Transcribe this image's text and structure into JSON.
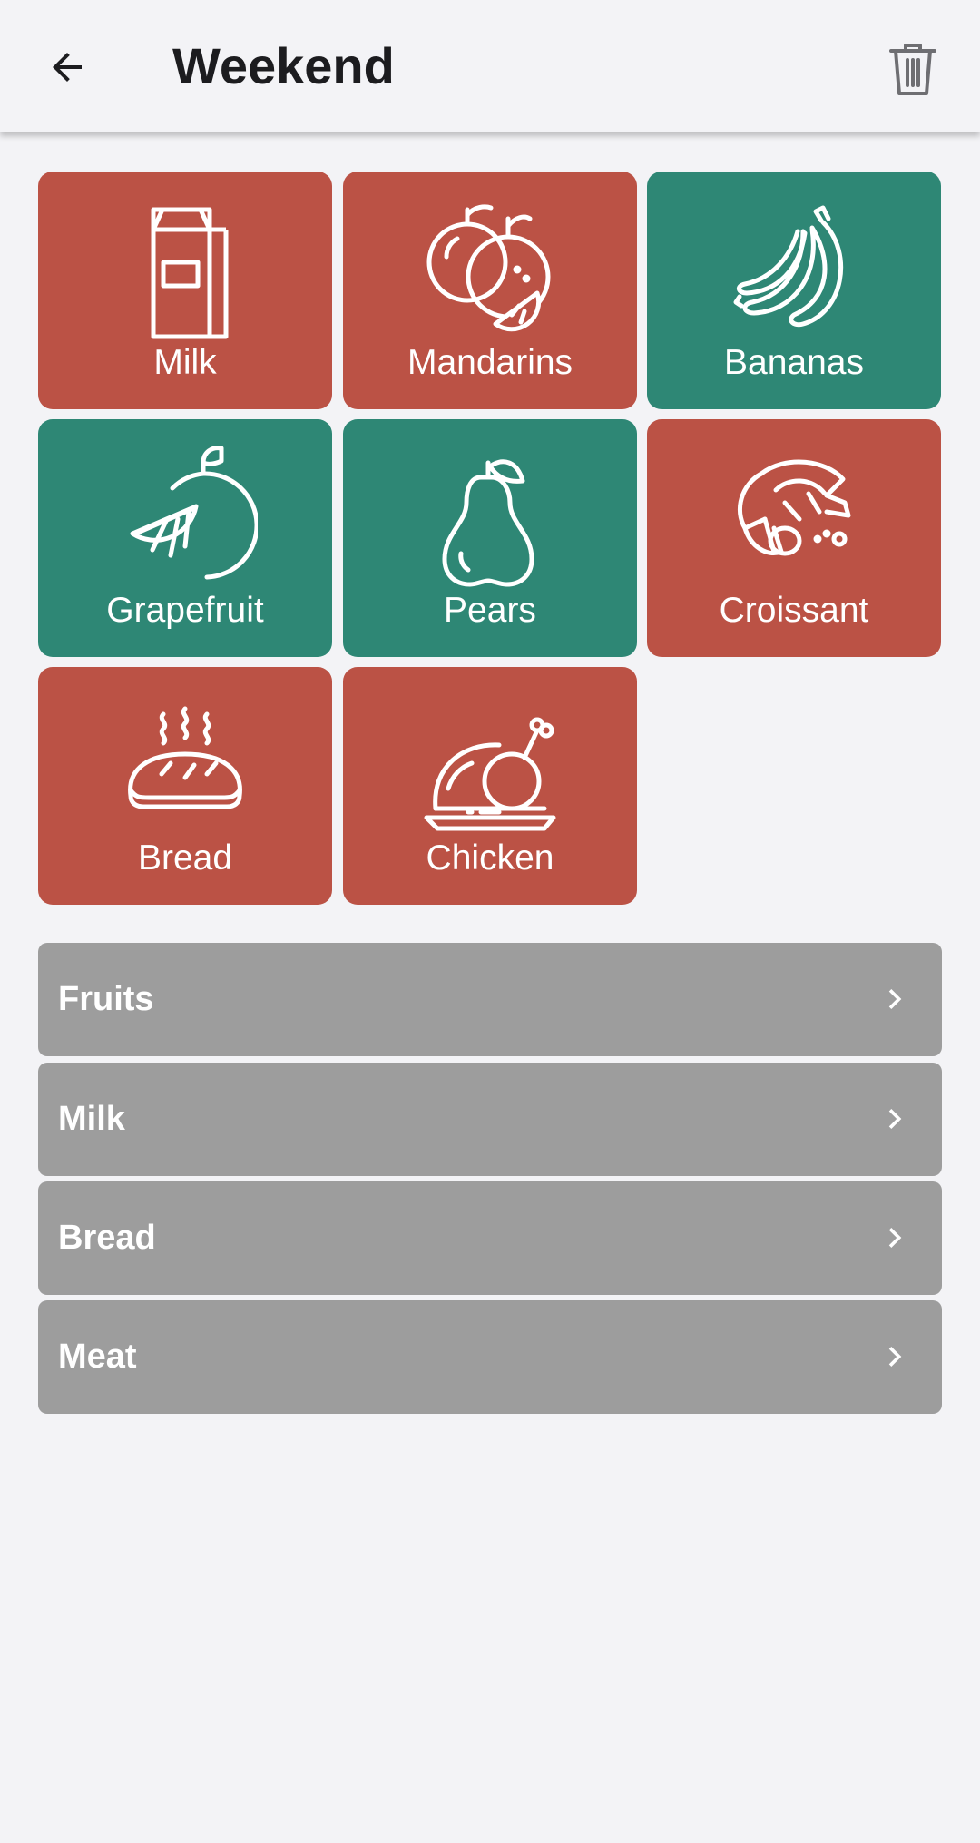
{
  "header": {
    "title": "Weekend",
    "back_icon": "arrow-back-icon",
    "delete_icon": "trash-icon"
  },
  "colors": {
    "not_purchased": "#bb5245",
    "purchased": "#2e8775",
    "category_bg": "#9d9d9d",
    "background": "#f3f3f6"
  },
  "items": [
    {
      "label": "Milk",
      "icon": "milk-carton-icon",
      "status": "not_purchased"
    },
    {
      "label": "Mandarins",
      "icon": "mandarins-icon",
      "status": "not_purchased"
    },
    {
      "label": "Bananas",
      "icon": "bananas-icon",
      "status": "purchased"
    },
    {
      "label": "Grapefruit",
      "icon": "grapefruit-icon",
      "status": "purchased"
    },
    {
      "label": "Pears",
      "icon": "pear-icon",
      "status": "purchased"
    },
    {
      "label": "Croissant",
      "icon": "croissant-icon",
      "status": "not_purchased"
    },
    {
      "label": "Bread",
      "icon": "bread-icon",
      "status": "not_purchased"
    },
    {
      "label": "Chicken",
      "icon": "roast-chicken-icon",
      "status": "not_purchased"
    }
  ],
  "categories": [
    {
      "label": "Fruits"
    },
    {
      "label": "Milk"
    },
    {
      "label": "Bread"
    },
    {
      "label": "Meat"
    }
  ]
}
